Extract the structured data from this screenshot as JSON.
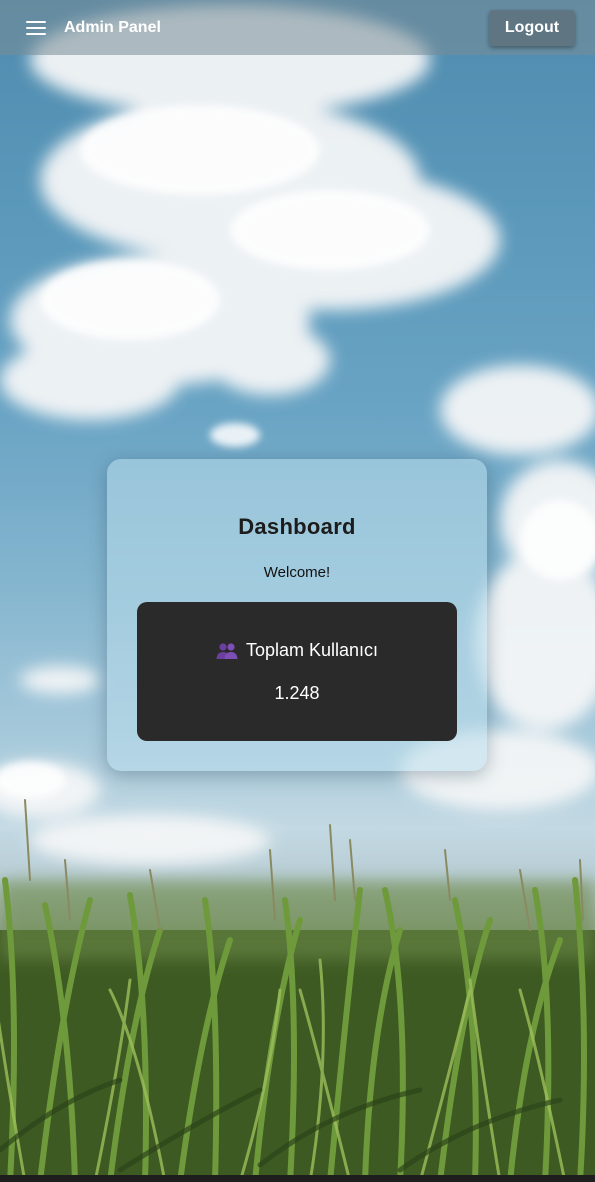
{
  "topbar": {
    "menu_icon": "hamburger-menu-icon",
    "title": "Admin Panel",
    "logout_label": "Logout"
  },
  "dashboard": {
    "title": "Dashboard",
    "welcome": "Welcome!",
    "stat": {
      "icon": "users-icon",
      "label": "Toplam Kullanıcı",
      "value": "1.248"
    }
  },
  "colors": {
    "topbar_bg": "#788c96",
    "card_bg": "#b9dceb",
    "stat_bg": "#2a2a2a",
    "users_icon": "#6b3fa0"
  }
}
